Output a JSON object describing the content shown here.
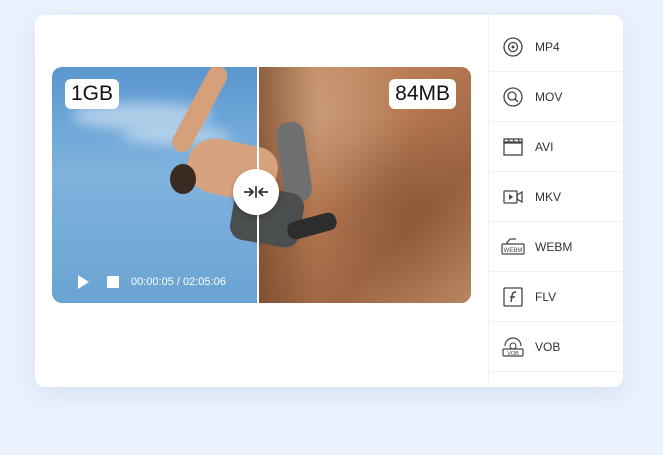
{
  "preview": {
    "original_size": "1GB",
    "compressed_size": "84MB",
    "time": "00:00:05 / 02:05:06"
  },
  "formats": [
    {
      "label": "MP4",
      "icon": "disc-icon"
    },
    {
      "label": "MOV",
      "icon": "disc-search-icon"
    },
    {
      "label": "AVI",
      "icon": "clapperboard-icon"
    },
    {
      "label": "MKV",
      "icon": "video-camera-icon"
    },
    {
      "label": "WEBM",
      "icon": "webm-icon"
    },
    {
      "label": "FLV",
      "icon": "flash-icon"
    },
    {
      "label": "VOB",
      "icon": "vob-icon"
    }
  ],
  "colors": {
    "background": "#eaf2fd",
    "card": "#ffffff",
    "text": "#333333"
  }
}
